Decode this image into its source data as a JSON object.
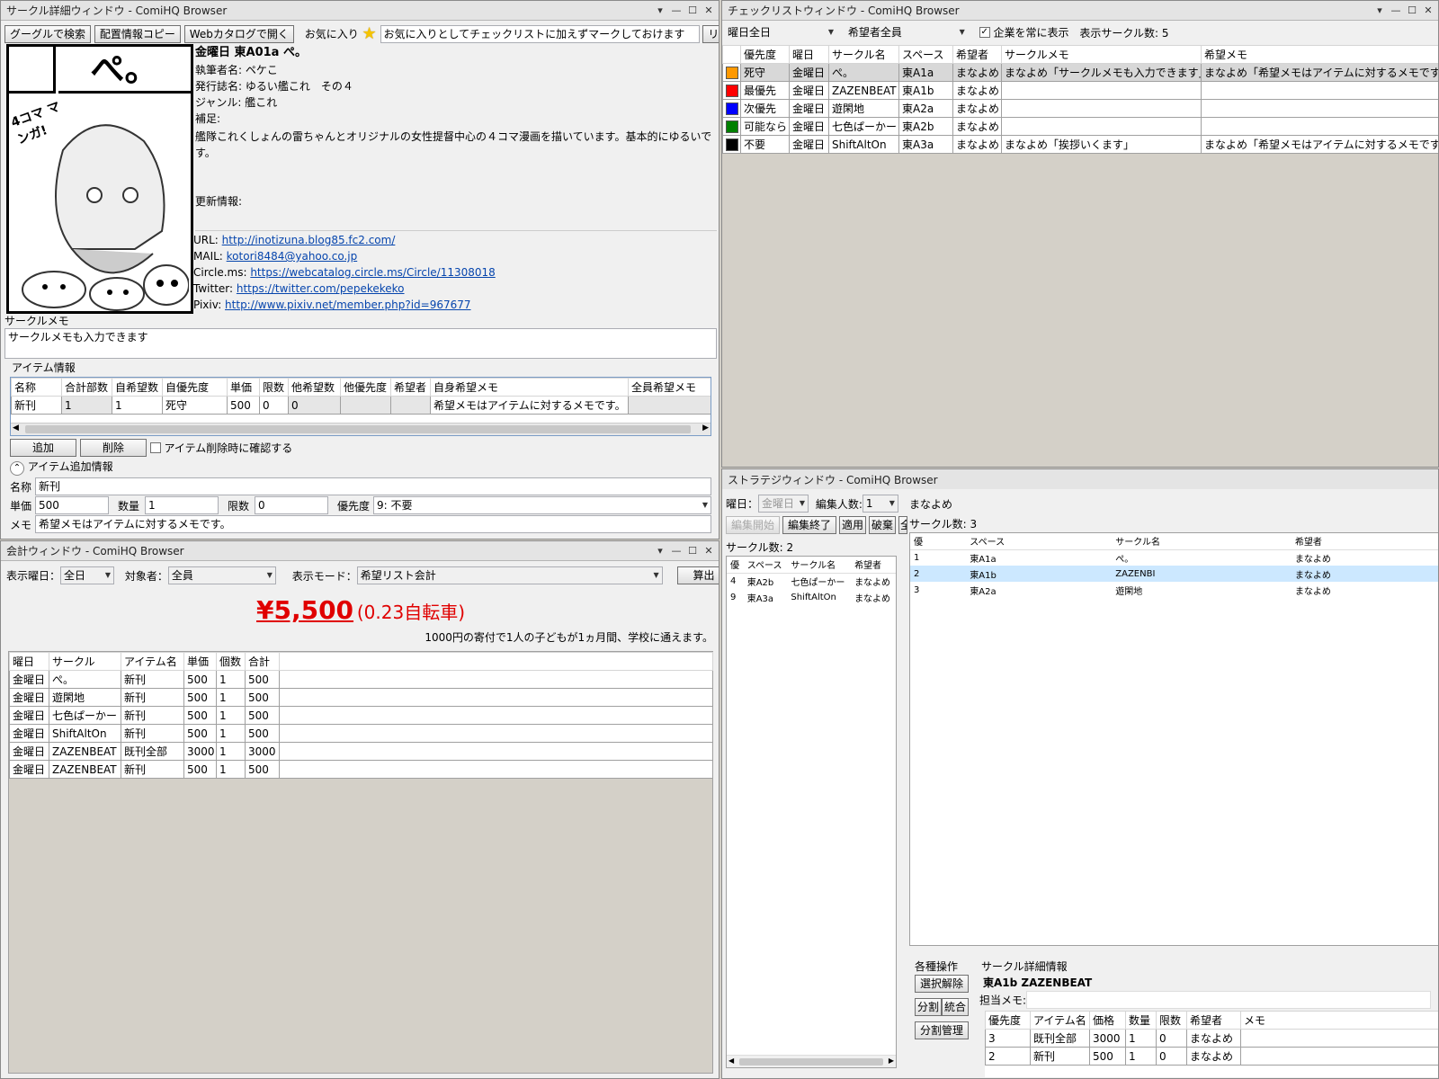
{
  "detail": {
    "title": "サークル詳細ウィンドウ - ComiHQ Browser",
    "toolbar": {
      "google": "グーグルで検索",
      "copy": "配置情報コピー",
      "web": "Webカタログで開く",
      "fav_label": "お気に入り",
      "fav_input": "お気に入りとしてチェックリストに加えずマークしておけます",
      "list": "リスト"
    },
    "header": "金曜日 東A01a ぺ。",
    "image_text": "ぺ。",
    "manga_text": "4コマ マンガ!",
    "info": [
      {
        "k": "執筆者名:",
        "v": "ペケこ"
      },
      {
        "k": "発行誌名:",
        "v": "ゆるい艦これ　その４"
      },
      {
        "k": "ジャンル:",
        "v": "艦これ"
      },
      {
        "k": "補足:",
        "v": ""
      }
    ],
    "description": "艦隊これくしょんの雷ちゃんとオリジナルの女性提督中心の４コマ漫画を描いています。基本的にゆるいです。",
    "update_label": "更新情報:",
    "links": [
      {
        "k": "URL:",
        "v": "http://inotizuna.blog85.fc2.com/"
      },
      {
        "k": "MAIL:",
        "v": "kotori8484@yahoo.co.jp"
      },
      {
        "k": "Circle.ms:",
        "v": "https://webcatalog.circle.ms/Circle/11308018"
      },
      {
        "k": "Twitter:",
        "v": "https://twitter.com/pepekekeko"
      },
      {
        "k": "Pixiv:",
        "v": "http://www.pixiv.net/member.php?id=967677"
      }
    ],
    "memo_label": "サークルメモ",
    "memo_value": "サークルメモも入力できます",
    "items_label": "アイテム情報",
    "items_headers": [
      "名称",
      "合計部数",
      "自希望数",
      "自優先度",
      "単価",
      "限数",
      "他希望数",
      "他優先度",
      "希望者",
      "自身希望メモ",
      "全員希望メモ"
    ],
    "items_row": [
      "新刊",
      "1",
      "1",
      "死守",
      "500",
      "0",
      "0",
      "",
      "",
      "希望メモはアイテムに対するメモです。",
      ""
    ],
    "add_btn": "追加",
    "del_btn": "削除",
    "confirm_label": "アイテム削除時に確認する",
    "addinfo_label": "アイテム追加情報",
    "f_name_k": "名称",
    "f_name_v": "新刊",
    "f_price_k": "単価",
    "f_price_v": "500",
    "f_qty_k": "数量",
    "f_qty_v": "1",
    "f_limit_k": "限数",
    "f_limit_v": "0",
    "f_pri_k": "優先度",
    "f_pri_v": "9: 不要",
    "f_memo_k": "メモ",
    "f_memo_v": "希望メモはアイテムに対するメモです。"
  },
  "checklist": {
    "title": "チェックリストウィンドウ - ComiHQ Browser",
    "day_sel": "曜日全日",
    "user_sel": "希望者全員",
    "corp_label": "企業を常に表示",
    "count_label": "表示サークル数: 5",
    "headers": [
      "優先度",
      "曜日",
      "サークル名",
      "スペース",
      "希望者",
      "サークルメモ",
      "希望メモ"
    ],
    "rows": [
      {
        "color": "#ff9900",
        "c": [
          "死守",
          "金曜日",
          "ぺ。",
          "東A1a",
          "まなよめ",
          "まなよめ「サークルメモも入力できます」",
          "まなよめ「希望メモはアイテムに対するメモです」"
        ]
      },
      {
        "color": "#ff0000",
        "c": [
          "最優先",
          "金曜日",
          "ZAZENBEAT",
          "東A1b",
          "まなよめ",
          "",
          ""
        ]
      },
      {
        "color": "#0000ff",
        "c": [
          "次優先",
          "金曜日",
          "遊閑地",
          "東A2a",
          "まなよめ",
          "",
          ""
        ]
      },
      {
        "color": "#008000",
        "c": [
          "可能なら",
          "金曜日",
          "七色ぱーかー",
          "東A2b",
          "まなよめ",
          "",
          ""
        ]
      },
      {
        "color": "#000000",
        "c": [
          "不要",
          "金曜日",
          "ShiftAltOn",
          "東A3a",
          "まなよめ",
          "まなよめ「挨拶いくます」",
          "まなよめ「希望メモはアイテムに対するメモです」"
        ]
      }
    ]
  },
  "accounting": {
    "title": "会計ウィンドウ - ComiHQ Browser",
    "day_k": "表示曜日：",
    "day_v": "全日",
    "target_k": "対象者：",
    "target_v": "全員",
    "mode_k": "表示モード：",
    "mode_v": "希望リスト会計",
    "calc": "算出",
    "total": "¥5,500",
    "total_sub": "(0.23自転車)",
    "note": "1000円の寄付で1人の子どもが1ヵ月間、学校に通えます。",
    "headers": [
      "曜日",
      "サークル",
      "アイテム名",
      "単価",
      "個数",
      "合計"
    ],
    "rows": [
      [
        "金曜日",
        "ぺ。",
        "新刊",
        "500",
        "1",
        "500"
      ],
      [
        "金曜日",
        "遊閑地",
        "新刊",
        "500",
        "1",
        "500"
      ],
      [
        "金曜日",
        "七色ぱーかー",
        "新刊",
        "500",
        "1",
        "500"
      ],
      [
        "金曜日",
        "ShiftAltOn",
        "新刊",
        "500",
        "1",
        "500"
      ],
      [
        "金曜日",
        "ZAZENBEAT",
        "既刊全部",
        "3000",
        "1",
        "3000"
      ],
      [
        "金曜日",
        "ZAZENBEAT",
        "新刊",
        "500",
        "1",
        "500"
      ]
    ]
  },
  "strategy": {
    "title": "ストラテジウィンドウ - ComiHQ Browser",
    "day_k": "曜日：",
    "day_v": "金曜日",
    "edit_k": "編集人数:",
    "edit_v": "1",
    "btn_start": "編集開始",
    "btn_end": "編集終了",
    "btn_apply": "適用",
    "btn_discard": "破棄",
    "btn_more": "全",
    "left_count": "サークル数: 2",
    "left_headers": [
      "優",
      "スペース",
      "サークル名",
      "希望者"
    ],
    "left_rows": [
      [
        "4",
        "東A2b",
        "七色ぱーかー",
        "まなよめ"
      ],
      [
        "9",
        "東A3a",
        "ShiftAltOn",
        "まなよめ"
      ]
    ],
    "user": "まなよめ",
    "right_count": "サークル数: 3",
    "right_headers": [
      "優",
      "スペース",
      "サークル名",
      "希望者"
    ],
    "right_rows": [
      [
        "1",
        "東A1a",
        "ぺ。",
        "まなよめ"
      ],
      [
        "2",
        "東A1b",
        "ZAZENBI",
        "まなよめ"
      ],
      [
        "3",
        "東A2a",
        "遊閑地",
        "まなよめ"
      ]
    ],
    "ops_label": "各種操作",
    "op_clear": "選択解除",
    "op_split": "分割",
    "op_merge": "統合",
    "op_splitmgr": "分割管理",
    "detail_label": "サークル詳細情報",
    "detail_name": "東A1b ZAZENBEAT",
    "memo_k": "担当メモ:",
    "d_headers": [
      "優先度",
      "アイテム名",
      "価格",
      "数量",
      "限数",
      "希望者",
      "メモ"
    ],
    "d_rows": [
      [
        "3",
        "既刊全部",
        "3000",
        "1",
        "0",
        "まなよめ",
        ""
      ],
      [
        "2",
        "新刊",
        "500",
        "1",
        "0",
        "まなよめ",
        ""
      ]
    ]
  }
}
